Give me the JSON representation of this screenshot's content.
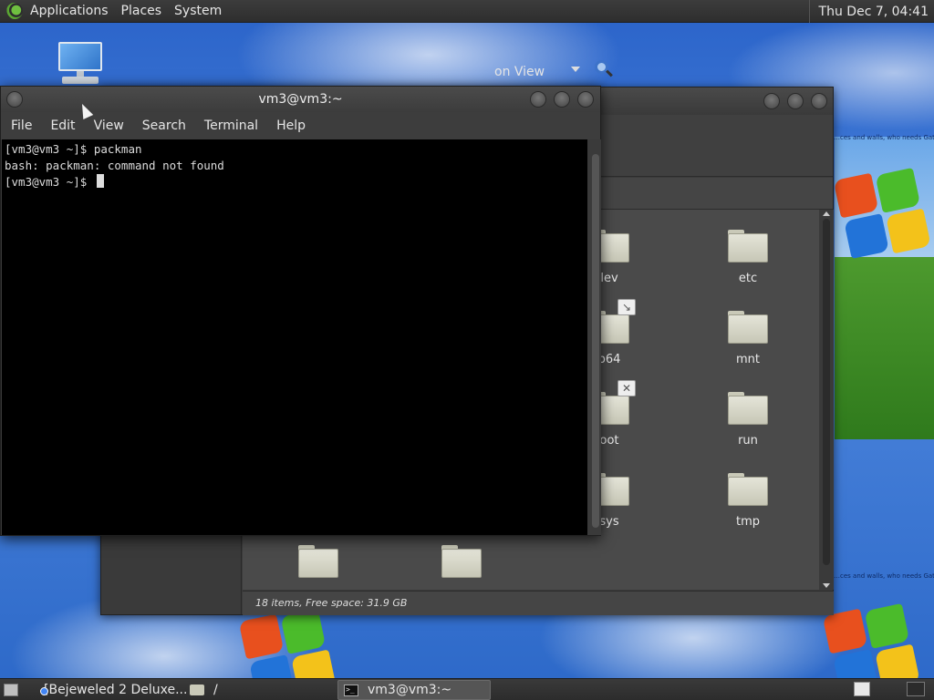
{
  "top_panel": {
    "menus": [
      "Applications",
      "Places",
      "System"
    ],
    "clock": "Thu Dec  7, 04:41"
  },
  "wallpaper": {
    "caption": "…ces and walls, who needs Gates a…"
  },
  "file_manager": {
    "view_mode": "on View",
    "folders": [
      {
        "label": "lev",
        "emblem": ""
      },
      {
        "label": "etc",
        "emblem": ""
      },
      {
        "label": "b64",
        "emblem": "link"
      },
      {
        "label": "mnt",
        "emblem": ""
      },
      {
        "label": "oot",
        "emblem": "cross"
      },
      {
        "label": "run",
        "emblem": ""
      },
      {
        "label": "sys",
        "emblem": ""
      },
      {
        "label": "tmp",
        "emblem": ""
      },
      {
        "label": "",
        "emblem": ""
      },
      {
        "label": "",
        "emblem": ""
      }
    ],
    "status": "18 items, Free space: 31.9 GB"
  },
  "terminal": {
    "title": "vm3@vm3:~",
    "menus": [
      "File",
      "Edit",
      "View",
      "Search",
      "Terminal",
      "Help"
    ],
    "lines": [
      "[vm3@vm3 ~]$ packman",
      "bash: packman: command not found",
      "[vm3@vm3 ~]$ "
    ]
  },
  "taskbar": {
    "tasks": [
      {
        "label": "[Bejeweled 2 Deluxe..."
      },
      {
        "label": "/"
      },
      {
        "label": "vm3@vm3:~"
      }
    ]
  },
  "colors": {
    "panel_bg": "#333333",
    "terminal_bg": "#000000",
    "folder": "#d8d8c8"
  }
}
